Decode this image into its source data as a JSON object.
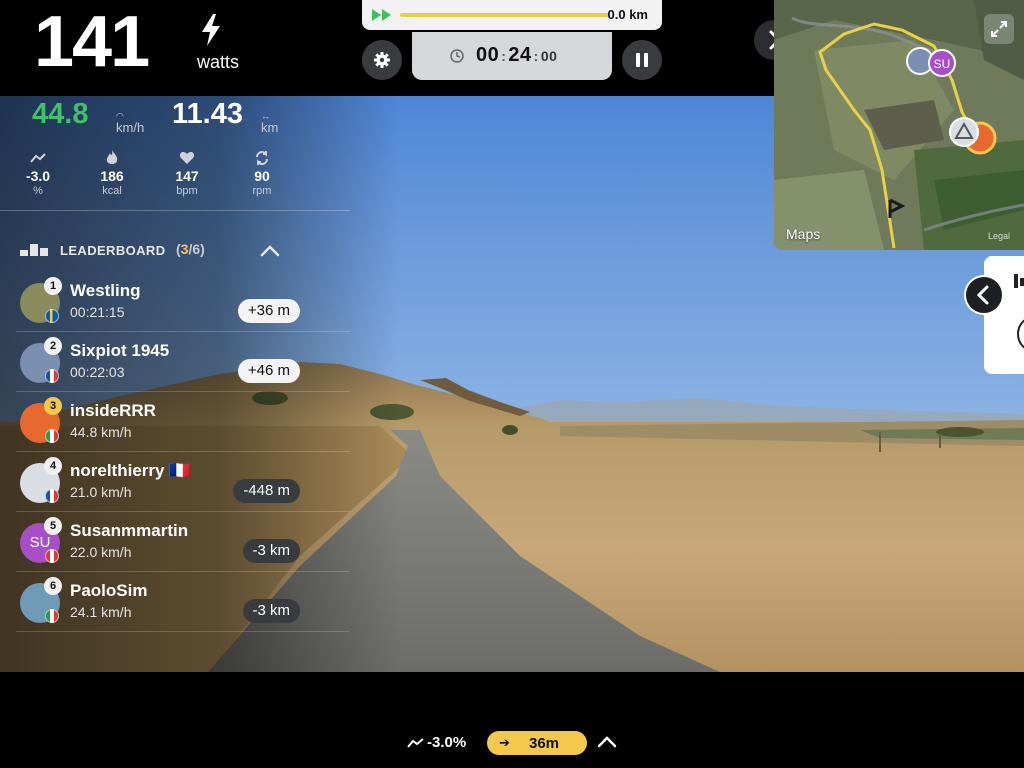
{
  "power": {
    "value": "141",
    "unit": "watts"
  },
  "speed": {
    "value": "44.8",
    "unit": "km/h"
  },
  "distance": {
    "value": "11.43",
    "unit": "km"
  },
  "metrics": [
    {
      "icon": "slope-icon",
      "value": "-3.0",
      "unit": "%"
    },
    {
      "icon": "flame-icon",
      "value": "186",
      "unit": "kcal"
    },
    {
      "icon": "heart-icon",
      "value": "147",
      "unit": "bpm"
    },
    {
      "icon": "cadence-icon",
      "value": "90",
      "unit": "rpm"
    }
  ],
  "route_progress": {
    "distance": "0.0 km",
    "fraction": 0.0
  },
  "timer": {
    "hours": "00",
    "minutes": "24",
    "seconds": "00"
  },
  "map": {
    "label": "Maps",
    "legal": "Legal"
  },
  "leaderboard": {
    "title": "LEADERBOARD",
    "position": "3",
    "total": "/6",
    "riders": [
      {
        "rank": "1",
        "name": "Westling",
        "sub": "00:21:15",
        "gap": "+36 m",
        "gap_style": "light",
        "flag": "se",
        "avatar_color": "#8a8c5e"
      },
      {
        "rank": "2",
        "name": "Sixpiot 1945",
        "sub": "00:22:03",
        "gap": "+46 m",
        "gap_style": "light",
        "flag": "fr",
        "avatar_color": "#7b8fb0"
      },
      {
        "rank": "3",
        "name": "insideRRR",
        "sub": "44.8 km/h",
        "gap": "",
        "gap_style": "",
        "flag": "it",
        "avatar_color": "#e8692f"
      },
      {
        "rank": "4",
        "name": "norelthierry 🇫🇷",
        "sub": "21.0 km/h",
        "gap": "-448 m",
        "gap_style": "dark",
        "flag": "fr",
        "avatar_color": "#d9dde4"
      },
      {
        "rank": "5",
        "name": "Susanmmartin",
        "sub": "22.0 km/h",
        "gap": "-3 km",
        "gap_style": "dark",
        "flag": "ca",
        "avatar_color": "#a64fc6",
        "initials": "SU"
      },
      {
        "rank": "6",
        "name": "PaoloSim",
        "sub": "24.1 km/h",
        "gap": "-3 km",
        "gap_style": "dark",
        "flag": "it",
        "avatar_color": "#6f9ab8"
      }
    ]
  },
  "bottom": {
    "slope": "-3.0%",
    "ahead": "36m"
  },
  "colors": {
    "accent_yellow": "#f2c94c",
    "speed_green": "#43c06a",
    "panel_dark": "#3a3b3e"
  }
}
